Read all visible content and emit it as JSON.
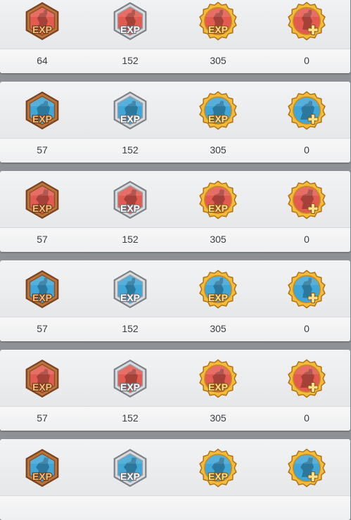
{
  "colors": {
    "red_art": "#e35a50",
    "blue_art": "#3ea6d8",
    "bronze": "#a46532",
    "silver": "#b9bcc1",
    "gold": "#e5a52a"
  },
  "rows": [
    {
      "art": "red",
      "values": [
        "64",
        "152",
        "305",
        "0"
      ]
    },
    {
      "art": "blue",
      "values": [
        "57",
        "152",
        "305",
        "0"
      ]
    },
    {
      "art": "red",
      "values": [
        "57",
        "152",
        "305",
        "0"
      ]
    },
    {
      "art": "blue",
      "values": [
        "57",
        "152",
        "305",
        "0"
      ]
    },
    {
      "art": "red",
      "values": [
        "57",
        "152",
        "305",
        "0"
      ]
    },
    {
      "art": "blue",
      "values": [
        "",
        "",
        "",
        ""
      ]
    }
  ],
  "medal_tiers": [
    {
      "tier": "bronze",
      "shape": "hexagon",
      "label": "EXP",
      "icon": "bronze-exp-medal-icon"
    },
    {
      "tier": "silver",
      "shape": "hexagon",
      "label": "EXP",
      "icon": "silver-exp-medal-icon"
    },
    {
      "tier": "gold",
      "shape": "seal",
      "label": "EXP",
      "icon": "gold-exp-medal-icon"
    },
    {
      "tier": "gold",
      "shape": "seal",
      "label": "+",
      "icon": "gold-plus-medal-icon"
    }
  ]
}
